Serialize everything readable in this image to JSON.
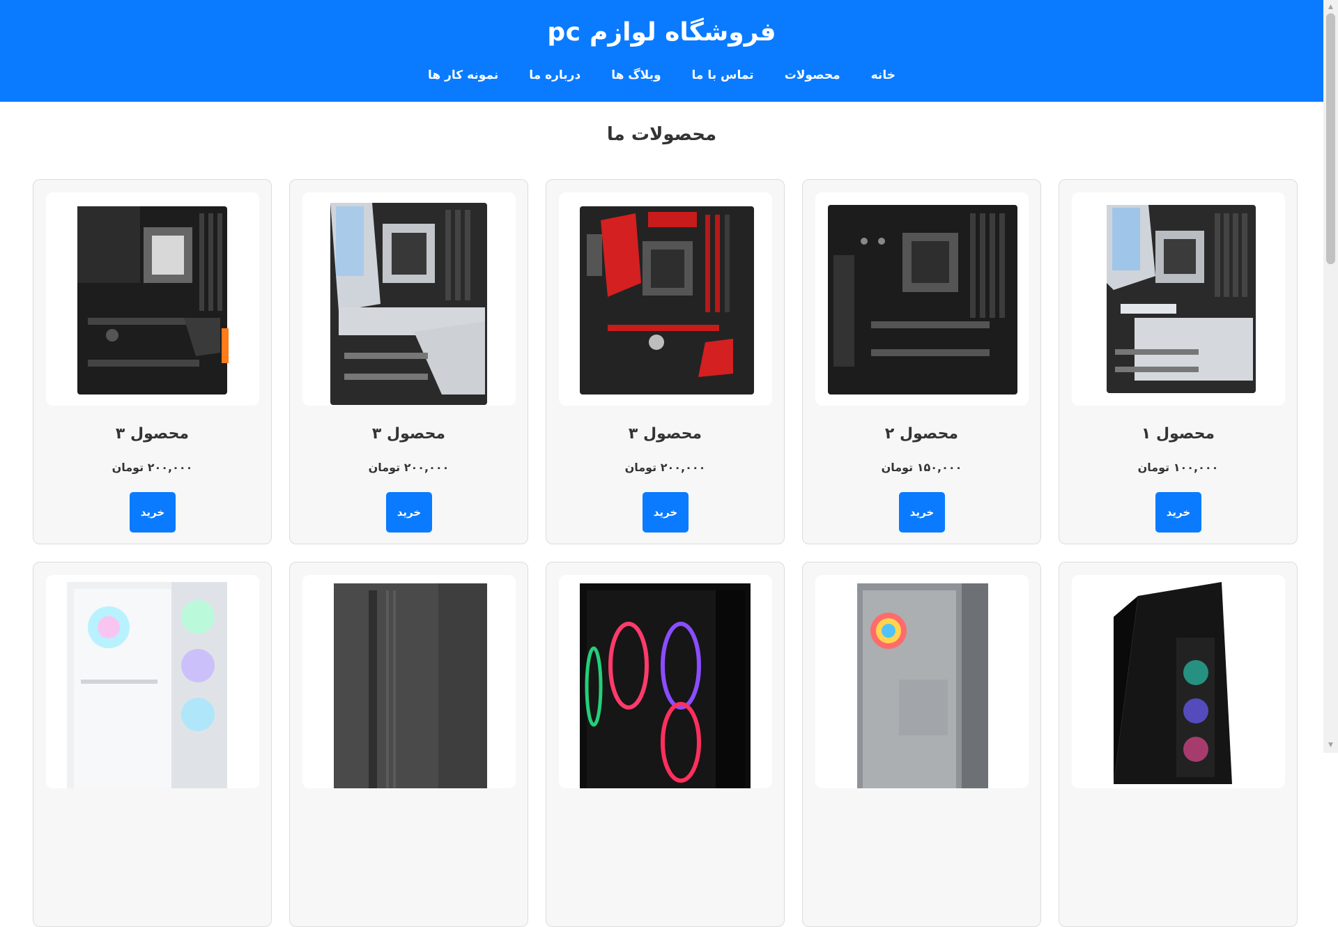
{
  "header": {
    "title": "فروشگاه لوازم pc",
    "nav": [
      "خانه",
      "محصولات",
      "تماس با ما",
      "وبلاگ ها",
      "درباره ما",
      "نمونه کار ها"
    ]
  },
  "section": {
    "title": "محصولات ما"
  },
  "products": [
    {
      "name": "محصول ۱",
      "price": "۱۰۰,۰۰۰ تومان",
      "buy": "خرید",
      "image_icon": "motherboard-silver-icon"
    },
    {
      "name": "محصول ۲",
      "price": "۱۵۰,۰۰۰ تومان",
      "buy": "خرید",
      "image_icon": "motherboard-black-icon"
    },
    {
      "name": "محصول ۳",
      "price": "۲۰۰,۰۰۰ تومان",
      "buy": "خرید",
      "image_icon": "motherboard-red-icon"
    },
    {
      "name": "محصول ۳",
      "price": "۲۰۰,۰۰۰ تومان",
      "buy": "خرید",
      "image_icon": "motherboard-silver-icon"
    },
    {
      "name": "محصول ۳",
      "price": "۲۰۰,۰۰۰ تومان",
      "buy": "خرید",
      "image_icon": "motherboard-black-icon"
    }
  ],
  "cases": [
    {
      "image_icon": "pc-case-black-rgb-icon"
    },
    {
      "image_icon": "pc-case-glass-icon"
    },
    {
      "image_icon": "pc-case-rgb-icon"
    },
    {
      "image_icon": "pc-case-gray-icon"
    },
    {
      "image_icon": "pc-case-white-rgb-icon"
    }
  ],
  "colors": {
    "primary": "#0a7bff",
    "card_bg": "#f7f7f7",
    "header_text": "#ffffff"
  }
}
